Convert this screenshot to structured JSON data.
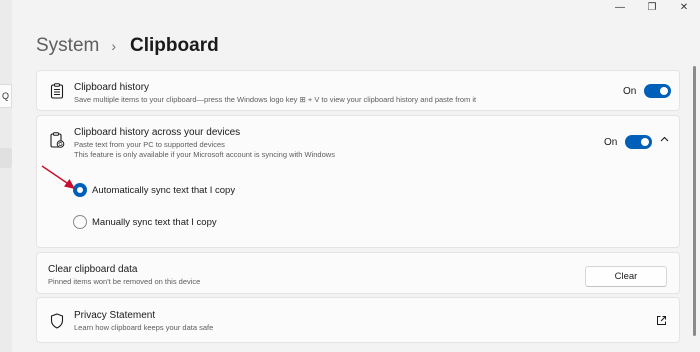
{
  "window": {
    "minimize_glyph": "—",
    "restore_glyph": "❐",
    "close_glyph": "✕"
  },
  "nav": {
    "search_glyph": "Q"
  },
  "breadcrumb": {
    "parent": "System",
    "separator": "›",
    "current": "Clipboard"
  },
  "clipboard_history": {
    "title": "Clipboard history",
    "description": "Save multiple items to your clipboard—press the Windows logo key ⊞ + V to view your clipboard history and paste from it",
    "toggle_label": "On",
    "toggle_on": true,
    "icon": "clipboard-list-icon"
  },
  "sync_devices": {
    "title": "Clipboard history across your devices",
    "description_line1": "Paste text from your PC to supported devices",
    "description_line2": "This feature is only available if your Microsoft account is syncing with Windows",
    "toggle_label": "On",
    "toggle_on": true,
    "expanded": true,
    "icon": "clipboard-sync-icon",
    "options": [
      {
        "label": "Automatically sync text that I copy",
        "checked": true
      },
      {
        "label": "Manually sync text that I copy",
        "checked": false
      }
    ]
  },
  "clear_data": {
    "title": "Clear clipboard data",
    "description": "Pinned items won't be removed on this device",
    "button_label": "Clear"
  },
  "privacy": {
    "title": "Privacy Statement",
    "description": "Learn how clipboard keeps your data safe",
    "icon": "shield-icon",
    "link_icon": "external-link-icon"
  },
  "colors": {
    "accent": "#005fb8",
    "annotation_arrow": "#c8102e",
    "card_bg": "#fbfbfb",
    "page_bg": "#f3f3f3"
  }
}
